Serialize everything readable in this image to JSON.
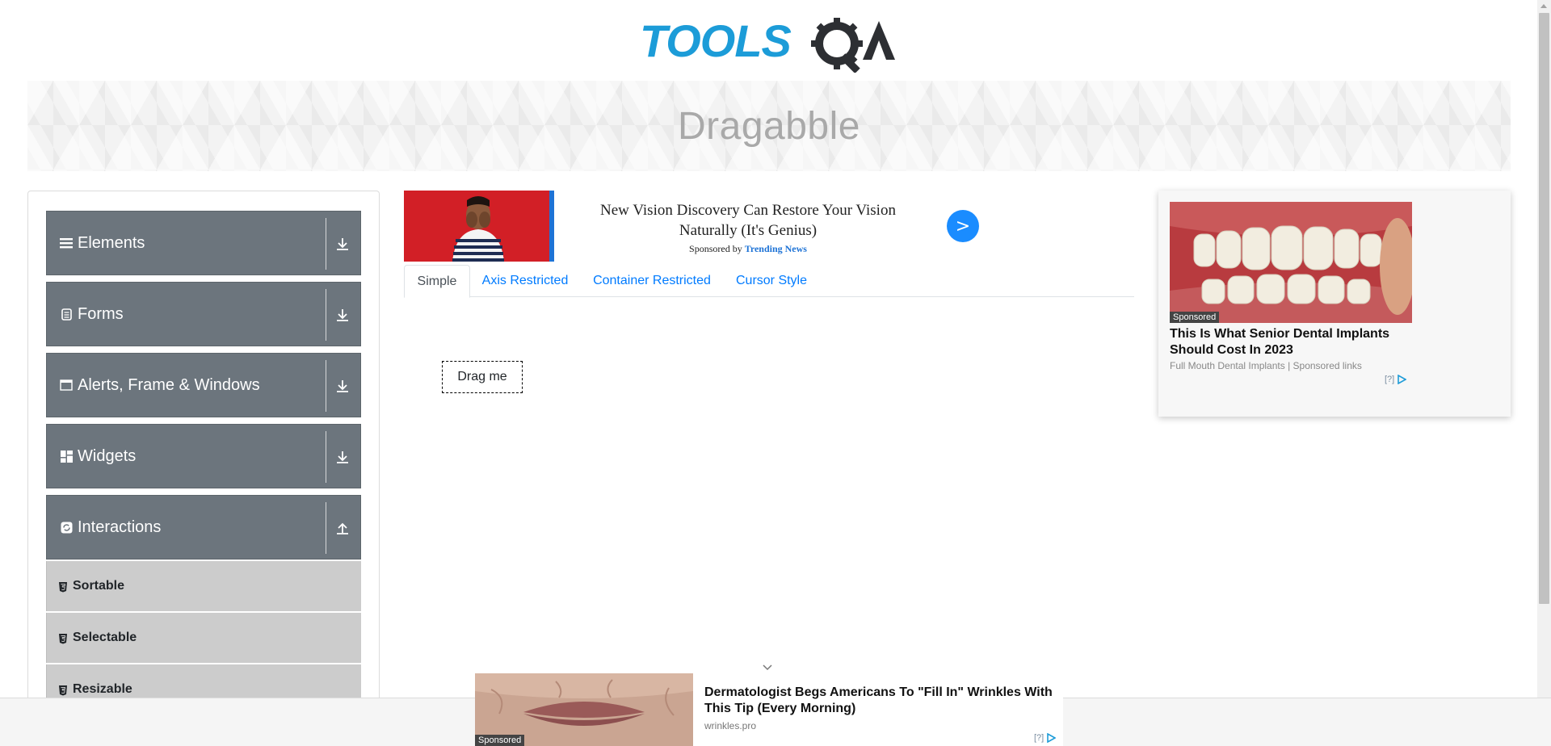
{
  "header": {
    "logo_text": "TOOLSQA",
    "page_title": "Dragabble"
  },
  "colors": {
    "logo_blue": "#1c9cd8",
    "logo_dark": "#2d2f33",
    "sidebar_group_bg": "#6c757d",
    "sidebar_sub_bg": "#cccccc",
    "tab_link": "#007bff",
    "ad_button": "#1a8cff"
  },
  "sidebar": {
    "groups": [
      {
        "label": "Elements",
        "icon": "hamburger-icon",
        "arrow": "download-icon"
      },
      {
        "label": "Forms",
        "icon": "document-icon",
        "arrow": "download-icon"
      },
      {
        "label": "Alerts, Frame & Windows",
        "icon": "window-icon",
        "arrow": "download-icon"
      },
      {
        "label": "Widgets",
        "icon": "grid-icon",
        "arrow": "download-icon"
      },
      {
        "label": "Interactions",
        "icon": "refresh-icon",
        "arrow": "upload-icon"
      }
    ],
    "sub_items": [
      {
        "label": "Sortable",
        "icon": "html5-icon"
      },
      {
        "label": "Selectable",
        "icon": "html5-icon"
      },
      {
        "label": "Resizable",
        "icon": "html5-icon"
      }
    ]
  },
  "top_ad": {
    "headline": "New Vision Discovery Can Restore Your Vision Naturally (It's Genius)",
    "sponsored_by": "Sponsored by",
    "sponsor_name": "Trending News",
    "button": ">"
  },
  "tabs": [
    {
      "label": "Simple",
      "active": true
    },
    {
      "label": "Axis Restricted",
      "active": false
    },
    {
      "label": "Container Restricted",
      "active": false
    },
    {
      "label": "Cursor Style",
      "active": false
    }
  ],
  "draggable": {
    "label": "Drag me"
  },
  "right_ad": {
    "tag": "Sponsored",
    "title": "This Is What Senior Dental Implants Should Cost In 2023",
    "source": "Full Mouth Dental Implants | Sponsored links",
    "adchoice": "[?]"
  },
  "bottom_ad": {
    "tag": "Sponsored",
    "title": "Dermatologist Begs Americans To \"Fill In\" Wrinkles With This Tip (Every Morning)",
    "source": "wrinkles.pro",
    "adchoice": "[?]"
  }
}
